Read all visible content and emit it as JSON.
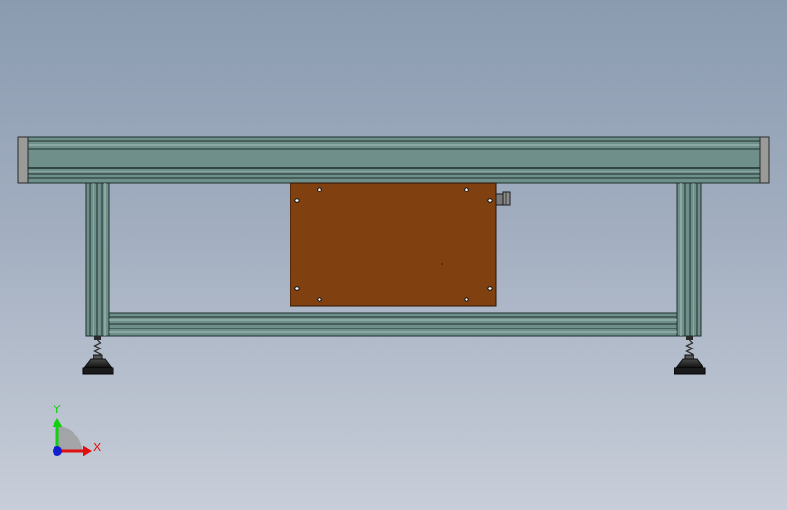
{
  "viewport": {
    "background_top": "#8a9bb0",
    "background_bottom": "#c8ced9"
  },
  "model": {
    "profile_color": "#6f8f8a",
    "profile_dark": "#1f2f2c",
    "end_cap_color": "#9a9a98",
    "panel_color": "#80400f",
    "foot_color": "#1a1a1a"
  },
  "triad": {
    "x_label": "X",
    "y_label": "Y",
    "x_color": "#e01010",
    "y_color": "#10d010",
    "z_color": "#1020d0"
  }
}
